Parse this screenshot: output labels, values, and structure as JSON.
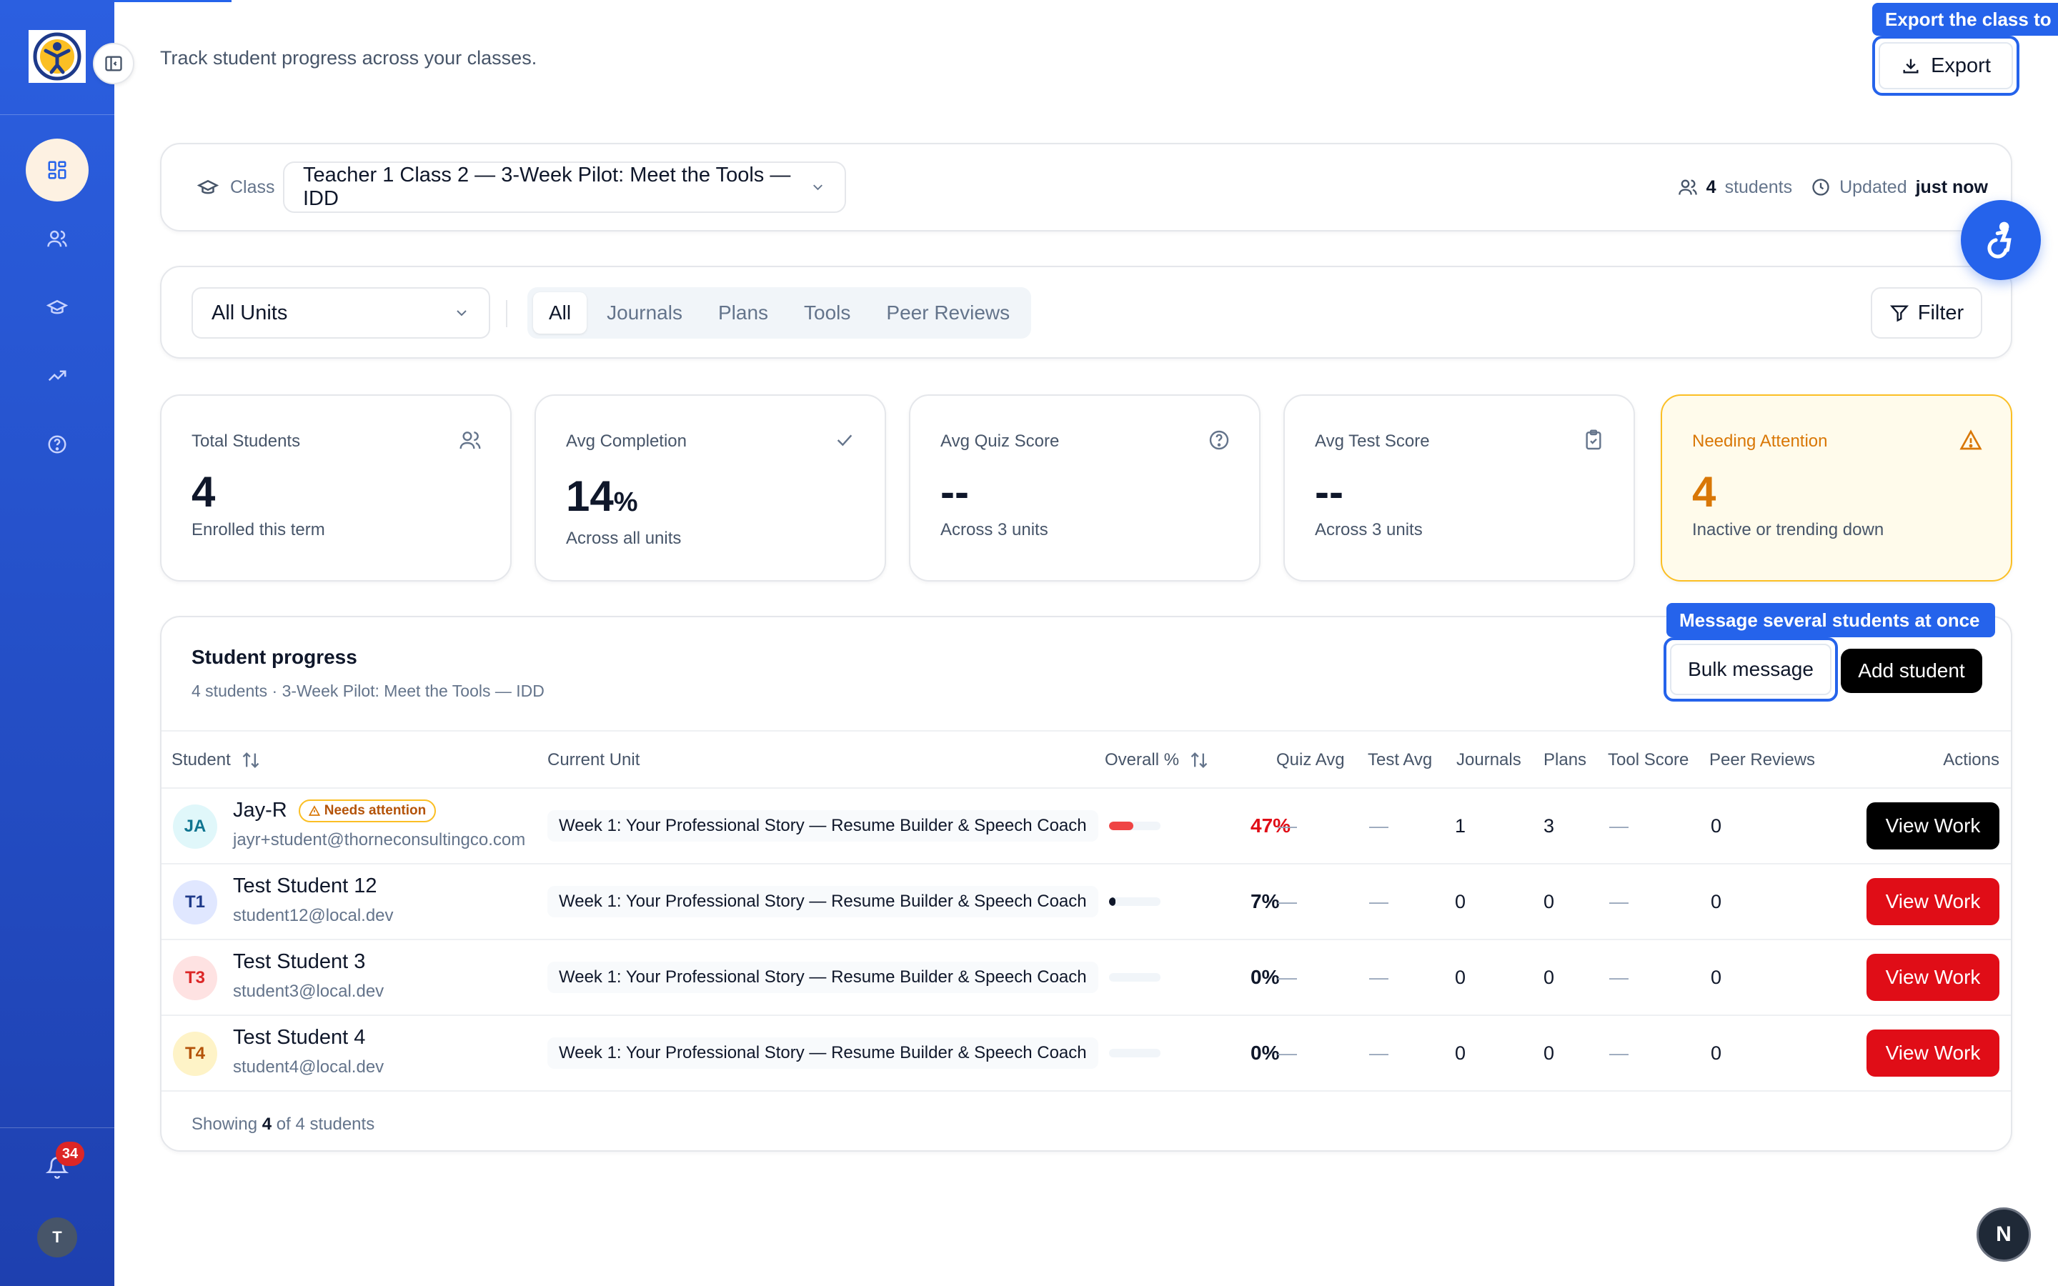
{
  "sidebar": {
    "notification_count": "34",
    "user_initial": "T",
    "nav": [
      "dashboard-icon",
      "users-icon",
      "graduation-cap-icon",
      "trending-up-icon",
      "help-circle-icon"
    ]
  },
  "header": {
    "subtitle": "Track student progress across your classes.",
    "export_tooltip": "Export the class to",
    "export_label": "Export"
  },
  "class_bar": {
    "label": "Class",
    "selected": "Teacher 1 Class 2 — 3-Week Pilot: Meet the Tools — IDD",
    "student_count": "4",
    "students_word": "students",
    "updated_label": "Updated",
    "updated_value": "just now"
  },
  "filters": {
    "units_selected": "All Units",
    "tabs": [
      "All",
      "Journals",
      "Plans",
      "Tools",
      "Peer Reviews"
    ],
    "active_tab": "All",
    "filter_label": "Filter"
  },
  "stats": [
    {
      "label": "Total Students",
      "value": "4",
      "unit": "",
      "sub": "Enrolled this term",
      "icon": "users-icon"
    },
    {
      "label": "Avg Completion",
      "value": "14",
      "unit": "%",
      "sub": "Across all units",
      "icon": "check-icon"
    },
    {
      "label": "Avg Quiz Score",
      "value": "--",
      "unit": "",
      "sub": "Across 3 units",
      "icon": "help-circle-icon"
    },
    {
      "label": "Avg Test Score",
      "value": "--",
      "unit": "",
      "sub": "Across 3 units",
      "icon": "clipboard-check-icon"
    },
    {
      "label": "Needing Attention",
      "value": "4",
      "unit": "",
      "sub": "Inactive or trending down",
      "icon": "alert-triangle-icon"
    }
  ],
  "progress": {
    "title": "Student progress",
    "subtitle": "4 students · 3-Week Pilot: Meet the Tools — IDD",
    "bulk_tooltip": "Message several students at once",
    "bulk_label": "Bulk message",
    "add_label": "Add student",
    "columns": [
      "Student",
      "Current Unit",
      "Overall %",
      "Quiz Avg",
      "Test Avg",
      "Journals",
      "Plans",
      "Tool Score",
      "Peer Reviews",
      "Actions"
    ],
    "needs_attention_label": "Needs attention",
    "view_label": "View Work",
    "rows": [
      {
        "initials": "JA",
        "name": "Jay-R",
        "email": "jayr+student@thorneconsultingco.com",
        "needs": true,
        "unit": "Week 1: Your Professional Story — Resume Builder & Speech Coach",
        "progress": 0.47,
        "overall": "47%",
        "quiz": "—",
        "test": "—",
        "journals": "1",
        "plans": "3",
        "tool": "—",
        "peer": "0"
      },
      {
        "initials": "T1",
        "name": "Test Student 12",
        "email": "student12@local.dev",
        "needs": false,
        "unit": "Week 1: Your Professional Story — Resume Builder & Speech Coach",
        "progress": 0.07,
        "overall": "7%",
        "quiz": "—",
        "test": "—",
        "journals": "0",
        "plans": "0",
        "tool": "—",
        "peer": "0"
      },
      {
        "initials": "T3",
        "name": "Test Student 3",
        "email": "student3@local.dev",
        "needs": false,
        "unit": "Week 1: Your Professional Story — Resume Builder & Speech Coach",
        "progress": 0,
        "overall": "0%",
        "quiz": "—",
        "test": "—",
        "journals": "0",
        "plans": "0",
        "tool": "—",
        "peer": "0"
      },
      {
        "initials": "T4",
        "name": "Test Student 4",
        "email": "student4@local.dev",
        "needs": false,
        "unit": "Week 1: Your Professional Story — Resume Builder & Speech Coach",
        "progress": 0,
        "overall": "0%",
        "quiz": "—",
        "test": "—",
        "journals": "0",
        "plans": "0",
        "tool": "—",
        "peer": "0"
      }
    ],
    "footer_prefix": "Showing",
    "footer_shown": "4",
    "footer_suffix": "of 4 students"
  },
  "colors": {
    "accent": "#2563eb",
    "danger": "#e00d17",
    "warning": "#d97706",
    "black": "#000000"
  }
}
